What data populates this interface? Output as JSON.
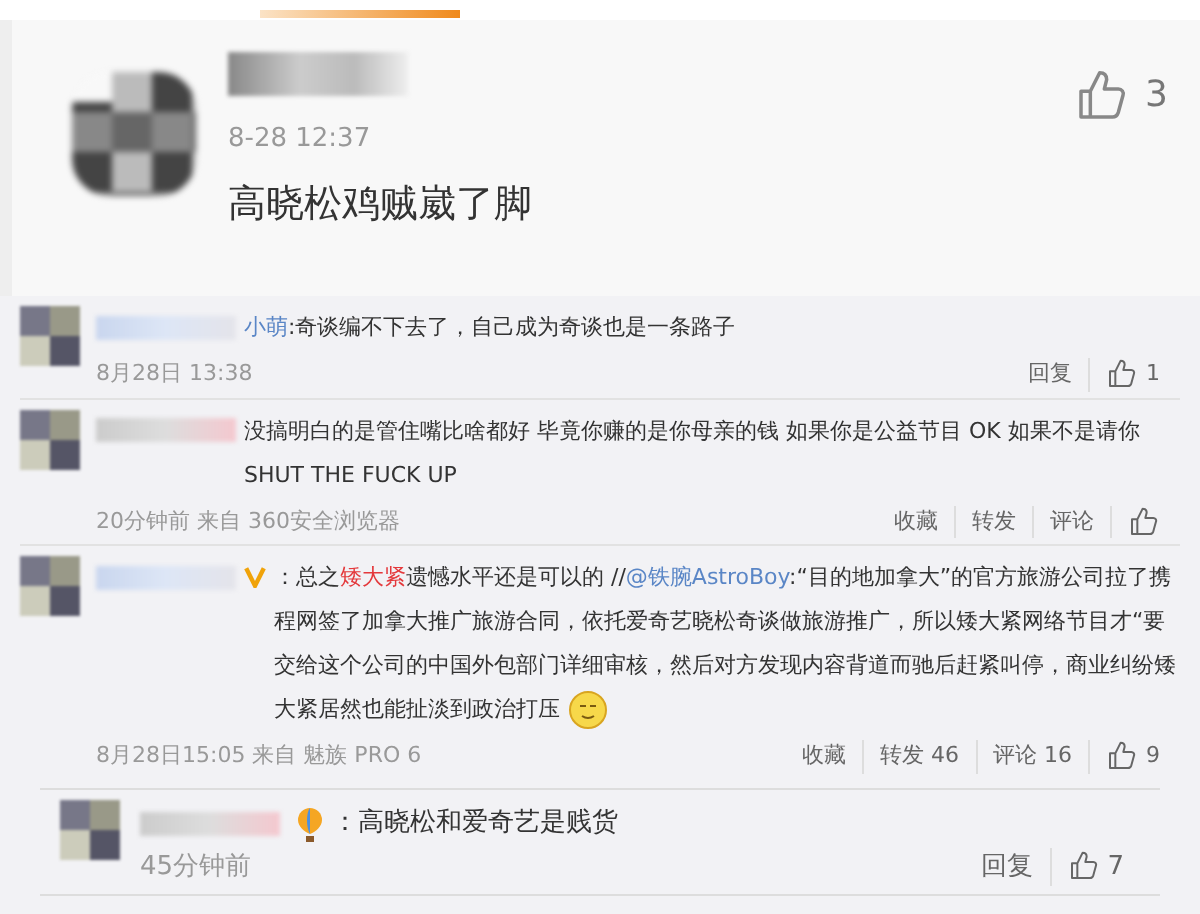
{
  "featured_comment": {
    "time": "8-28 12:37",
    "text": "高晓松鸡贼崴了脚",
    "likes": "3"
  },
  "comments": [
    {
      "name_visible": "小萌",
      "verified": false,
      "segments": [
        {
          "kind": "text",
          "text": ":奇谈编不下去了，自己成为奇谈也是一条路子"
        }
      ],
      "meta": "8月28日 13:38",
      "emoji": false,
      "actions": [
        {
          "kind": "text",
          "label": "回复"
        },
        {
          "kind": "like",
          "count": "1"
        }
      ]
    },
    {
      "verified": false,
      "segments": [
        {
          "kind": "text",
          "text": "没搞明白的是管住嘴比啥都好 毕竟你赚的是你母亲的钱 如果你是公益节目 OK 如果不是请你SHUT THE FUCK UP"
        }
      ],
      "meta": "20分钟前 来自 360安全浏览器",
      "emoji": false,
      "actions": [
        {
          "kind": "text",
          "label": "收藏"
        },
        {
          "kind": "text",
          "label": "转发"
        },
        {
          "kind": "text",
          "label": "评论"
        },
        {
          "kind": "like"
        }
      ]
    },
    {
      "verified": true,
      "segments": [
        {
          "kind": "text",
          "text": "：总之"
        },
        {
          "kind": "highlight",
          "text": "矮大紧"
        },
        {
          "kind": "text",
          "text": "遗憾水平还是可以的 //"
        },
        {
          "kind": "mention",
          "text": "@铁腕AstroBoy"
        },
        {
          "kind": "text",
          "text": ":“目的地加拿大”的官方旅游公司拉了携程网签了加拿大推广旅游合同，依托爱奇艺晓松奇谈做旅游推广，所以矮大紧网络节目才“要交给这个公司的中国外包部门详细审核，然后对方发现内容背道而驰后赶紧叫停，商业纠纷矮大紧居然也能扯淡到政治打压"
        }
      ],
      "meta": "8月28日15:05 来自 魅族 PRO 6",
      "emoji": true,
      "actions": [
        {
          "kind": "text",
          "label": "收藏"
        },
        {
          "kind": "text",
          "label": "转发 46"
        },
        {
          "kind": "text",
          "label": "评论 16"
        },
        {
          "kind": "like",
          "count": "9"
        }
      ]
    }
  ],
  "reply": {
    "text": "：高晓松和爱奇艺是贱货",
    "time": "45分钟前",
    "actions": [
      {
        "kind": "text",
        "label": "回复"
      },
      {
        "kind": "like",
        "count": "7"
      }
    ]
  }
}
